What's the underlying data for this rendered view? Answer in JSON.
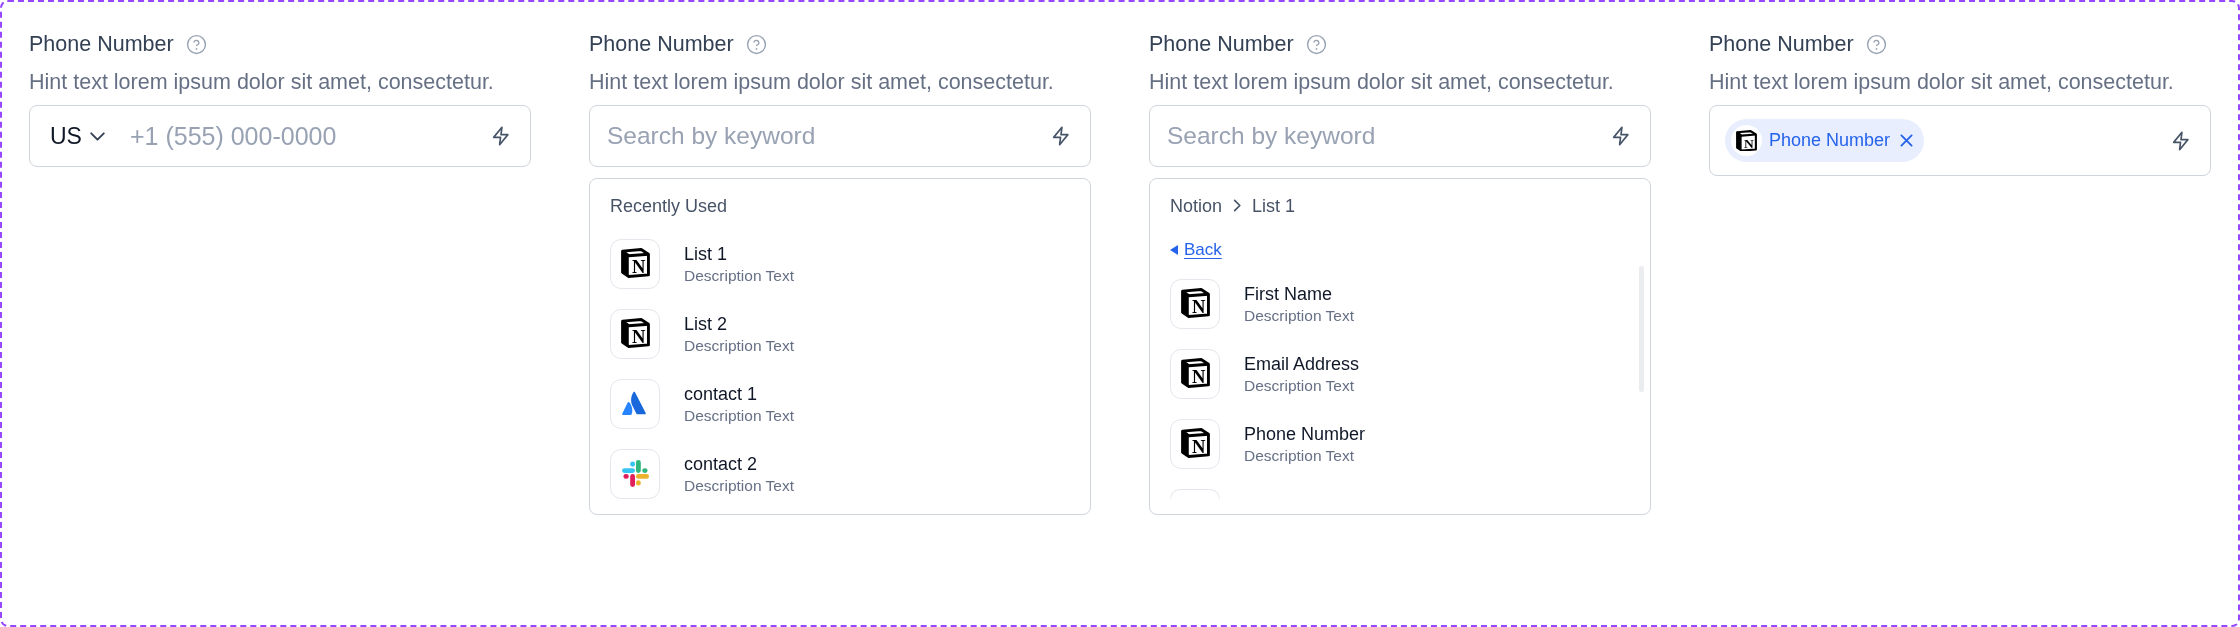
{
  "fields": [
    {
      "kind": "phone",
      "label": "Phone Number",
      "hint": "Hint text lorem ipsum dolor sit amet, consectetur.",
      "country": "US",
      "placeholder": "+1 (555) 000-0000"
    },
    {
      "kind": "search",
      "label": "Phone Number",
      "hint": "Hint text lorem ipsum dolor sit amet, consectetur.",
      "placeholder": "Search by keyword",
      "dropdown": {
        "heading": "Recently Used",
        "items": [
          {
            "kind": "cube",
            "letter": "N",
            "title": "List 1",
            "description": "Description Text"
          },
          {
            "kind": "cube",
            "letter": "N",
            "title": "List 2",
            "description": "Description Text"
          },
          {
            "kind": "peaks",
            "title": "contact 1",
            "description": "Description Text"
          },
          {
            "kind": "hash",
            "title": "contact 2",
            "description": "Description Text"
          }
        ]
      }
    },
    {
      "kind": "search",
      "label": "Phone Number",
      "hint": "Hint text lorem ipsum dolor sit amet, consectetur.",
      "placeholder": "Search by keyword",
      "dropdown": {
        "breadcrumb": [
          "Notion",
          "List 1"
        ],
        "back": "Back",
        "items": [
          {
            "kind": "cube",
            "letter": "N",
            "title": "First Name",
            "description": "Description Text"
          },
          {
            "kind": "cube",
            "letter": "N",
            "title": "Email Address",
            "description": "Description Text"
          },
          {
            "kind": "cube",
            "letter": "N",
            "title": "Phone Number",
            "description": "Description Text"
          },
          {
            "kind": "stub"
          }
        ]
      }
    },
    {
      "kind": "tags",
      "label": "Phone Number",
      "hint": "Hint text lorem ipsum dolor sit amet, consectetur.",
      "tags": [
        {
          "kind": "cube",
          "letter": "N",
          "label": "Phone Number"
        }
      ]
    }
  ]
}
